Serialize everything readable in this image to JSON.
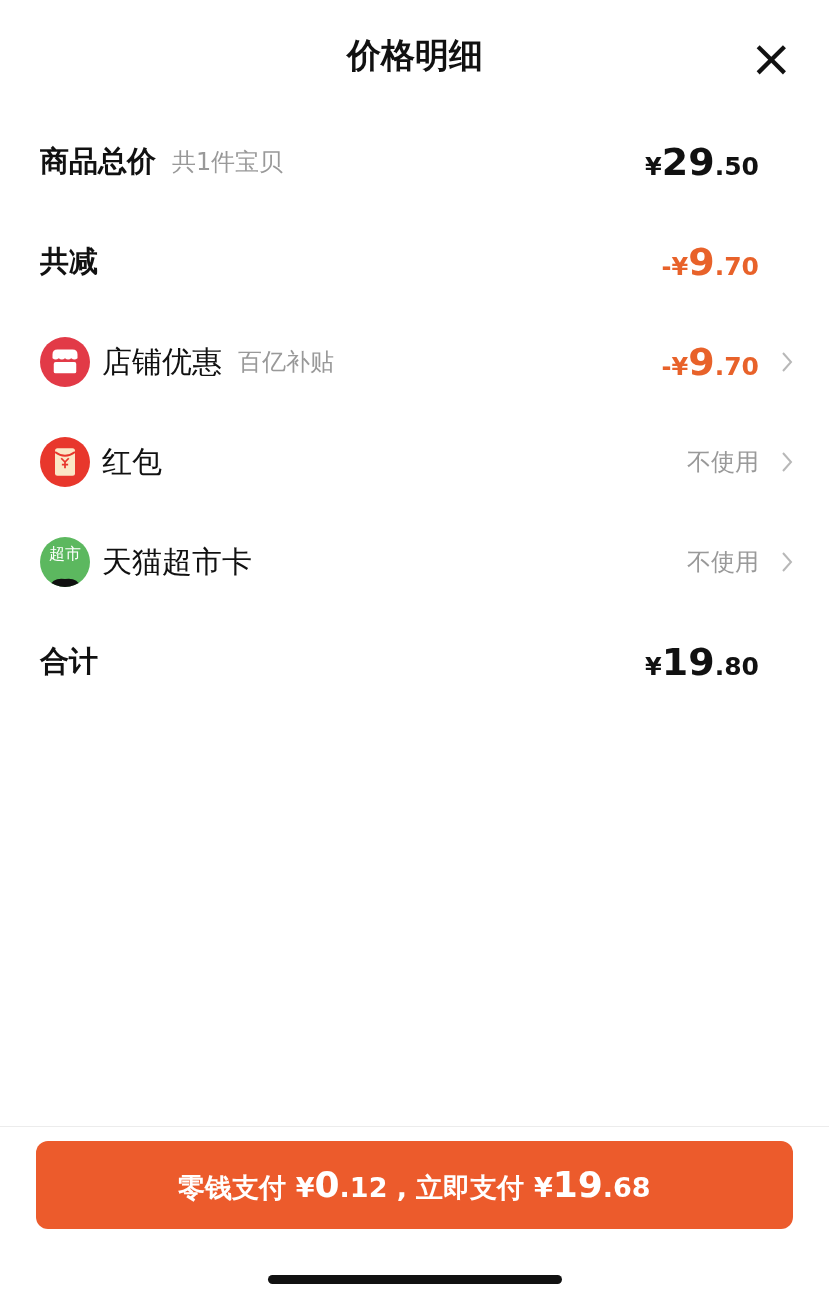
{
  "header": {
    "title": "价格明细",
    "close": "×"
  },
  "rows": [
    {
      "kind": "summary",
      "label": "商品总价",
      "note": "共1件宝贝",
      "price": {
        "prefix": "¥",
        "integer": "29",
        "decimal": ".50"
      },
      "discount": false,
      "chevron": false
    },
    {
      "kind": "summary",
      "label": "共减",
      "price": {
        "prefix": "-¥",
        "integer": "9",
        "decimal": ".70"
      },
      "discount": true,
      "chevron": false
    },
    {
      "kind": "store",
      "label": "店铺优惠",
      "note": "百亿补贴",
      "price": {
        "prefix": "-¥",
        "integer": "9",
        "decimal": ".70"
      },
      "discount": true,
      "chevron": true
    },
    {
      "kind": "envelope",
      "label": "红包",
      "value": "不使用",
      "chevron": true
    },
    {
      "kind": "card",
      "icon_text": "超市",
      "label": "天猫超市卡",
      "value": "不使用",
      "chevron": true
    },
    {
      "kind": "summary",
      "label": "合计",
      "price": {
        "prefix": "¥",
        "integer": "19",
        "decimal": ".80"
      },
      "discount": false,
      "chevron": false
    }
  ],
  "pay_button": {
    "segments": [
      {
        "text": "零钱支付 ¥",
        "big": false
      },
      {
        "text": "0",
        "big": true
      },
      {
        "text": ".12 , 立即支付 ¥",
        "big": false
      },
      {
        "text": "19",
        "big": true
      },
      {
        "text": ".68",
        "big": false
      }
    ]
  }
}
